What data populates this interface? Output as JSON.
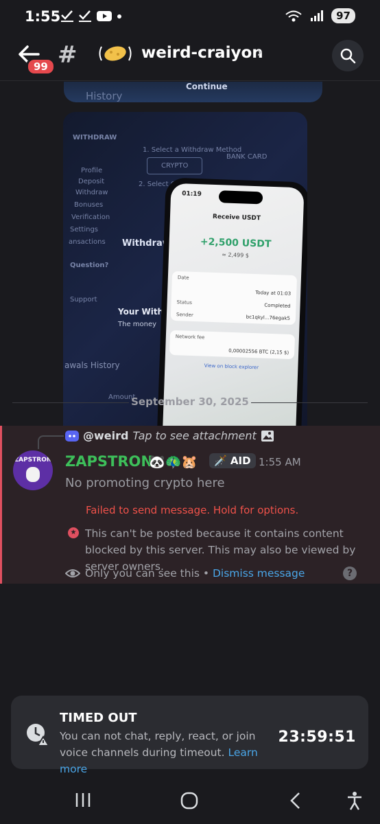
{
  "status_bar": {
    "time": "1:55",
    "battery": "97"
  },
  "header": {
    "unread_badge": "99",
    "channel_name": "weird-craiyon"
  },
  "attachment_top": {
    "label": "Continue",
    "faded_text": "History"
  },
  "photo": {
    "bg_texts": [
      "WITHDRAW",
      "1. Select a Withdraw Method",
      "CRYPTO",
      "BANK CARD",
      "2. Select Cryp",
      "Profile",
      "Deposit",
      "Withdraw",
      "Bonuses",
      "Verification",
      "Settings",
      "ansactions",
      "Withdrawa",
      "Question?",
      "Support",
      "Your Withd",
      "The money",
      "awals History",
      "Amount"
    ],
    "phone": {
      "time": "01:19",
      "title": "Receive USDT",
      "amount": "+2,500 USDT",
      "approx": "≈ 2,499 $",
      "rows": [
        {
          "label": "Date",
          "value": "Today at 01:03"
        },
        {
          "label": "Status",
          "value": "Completed"
        },
        {
          "label": "Sender",
          "value": "bc1qkyl...76egak5"
        }
      ],
      "fee_label": "Network fee",
      "fee_value": "0,00002556 BTC (2,15 $)",
      "link": "View on block explorer"
    }
  },
  "date_divider": "September 30, 2025",
  "message": {
    "reply_name": "@weird",
    "reply_text": "Tap to see attachment",
    "avatar_text": "ZAPSTRON",
    "username": "ZAPSTRON",
    "user_emojis": "🐼🦚🐹",
    "role_tag": "🗡️ AID",
    "time": "1:55 AM",
    "text": "No promoting crypto here",
    "failed": "Failed to send message. Hold for options.",
    "blocked": "This can't be posted because it contains content blocked by this server. This may also be viewed by server owners.",
    "only_you": "Only you can see this • ",
    "dismiss": "Dismiss message"
  },
  "timeout": {
    "title": "TIMED OUT",
    "text": "You can not chat, reply, react, or join voice channels during timeout. ",
    "learn_more": "Learn more",
    "timer": "23:59:51"
  },
  "colors": {
    "accent_green": "#3dbf5a",
    "error_red": "#f0524a",
    "link_blue": "#4aa6e8"
  }
}
